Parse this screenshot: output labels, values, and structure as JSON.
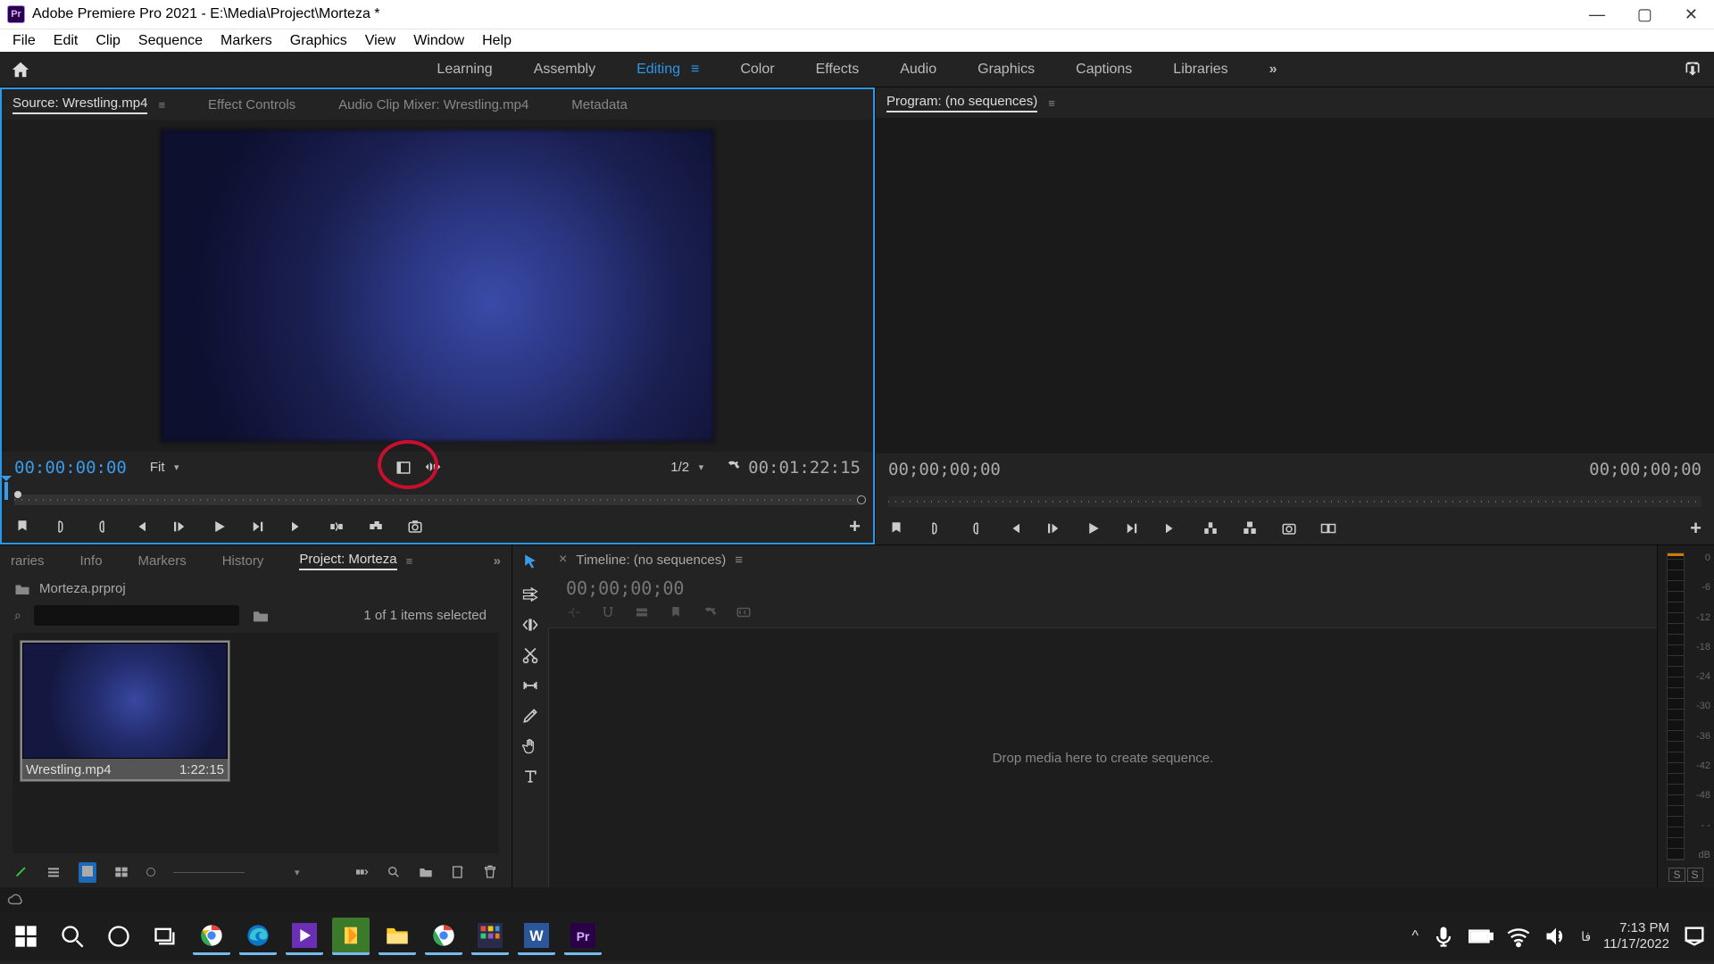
{
  "title": "Adobe Premiere Pro 2021 - E:\\Media\\Project\\Morteza *",
  "menu": [
    "File",
    "Edit",
    "Clip",
    "Sequence",
    "Markers",
    "Graphics",
    "View",
    "Window",
    "Help"
  ],
  "workspaces": [
    "Learning",
    "Assembly",
    "Editing",
    "Color",
    "Effects",
    "Audio",
    "Graphics",
    "Captions",
    "Libraries"
  ],
  "workspace_active_index": 2,
  "source": {
    "tabs": [
      "Source: Wrestling.mp4",
      "Effect Controls",
      "Audio Clip Mixer: Wrestling.mp4",
      "Metadata"
    ],
    "active_tab": 0,
    "timecode_cur": "00:00:00:00",
    "timecode_dur": "00:01:22:15",
    "fit": "Fit",
    "resolution": "1/2"
  },
  "program": {
    "tab": "Program: (no sequences)",
    "timecode_cur": "00;00;00;00",
    "timecode_dur": "00;00;00;00"
  },
  "project": {
    "tabs": [
      "raries",
      "Info",
      "Markers",
      "History",
      "Project: Morteza"
    ],
    "active_tab": 4,
    "projfile": "Morteza.prproj",
    "itemcount": "1 of 1 items selected",
    "clip": {
      "name": "Wrestling.mp4",
      "dur": "1:22:15"
    }
  },
  "timeline": {
    "tab": "Timeline: (no sequences)",
    "tc": "00;00;00;00",
    "drop": "Drop media here to create sequence."
  },
  "audio_scale": [
    "0",
    "-6",
    "-12",
    "-18",
    "-24",
    "-30",
    "-36",
    "-42",
    "-48",
    "- -",
    "dB"
  ],
  "audio_ss": [
    "S",
    "S"
  ],
  "taskbar": {
    "time": "7:13 PM",
    "date": "11/17/2022",
    "lang": "فا"
  }
}
